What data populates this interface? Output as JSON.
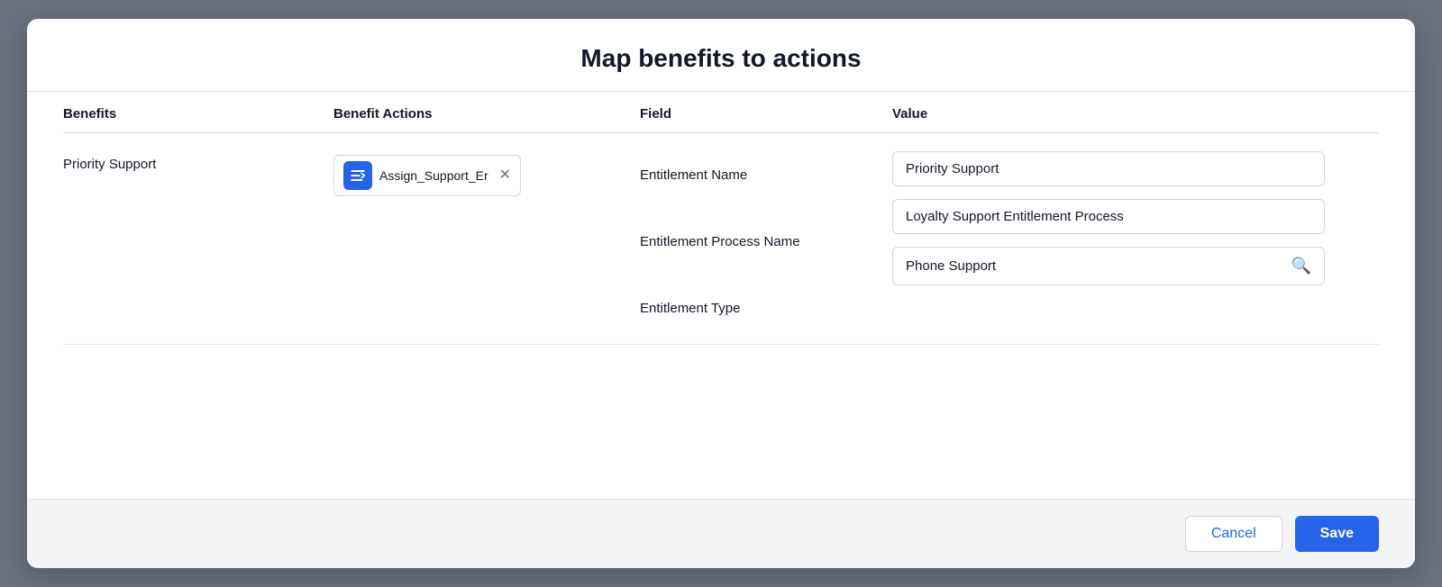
{
  "modal": {
    "title": "Map benefits to actions",
    "columns": {
      "benefits": "Benefits",
      "benefit_actions": "Benefit Actions",
      "field": "Field",
      "value": "Value"
    },
    "row": {
      "benefit_name": "Priority Support",
      "action_label": "Assign_Support_Er",
      "fields": [
        {
          "label": "Entitlement Name",
          "value": "Priority Support",
          "type": "text"
        },
        {
          "label": "Entitlement Process Name",
          "value": "Loyalty Support Entitlement Process",
          "type": "text"
        },
        {
          "label": "Entitlement Type",
          "value": "Phone Support",
          "type": "search"
        }
      ]
    },
    "footer": {
      "cancel_label": "Cancel",
      "save_label": "Save"
    }
  }
}
